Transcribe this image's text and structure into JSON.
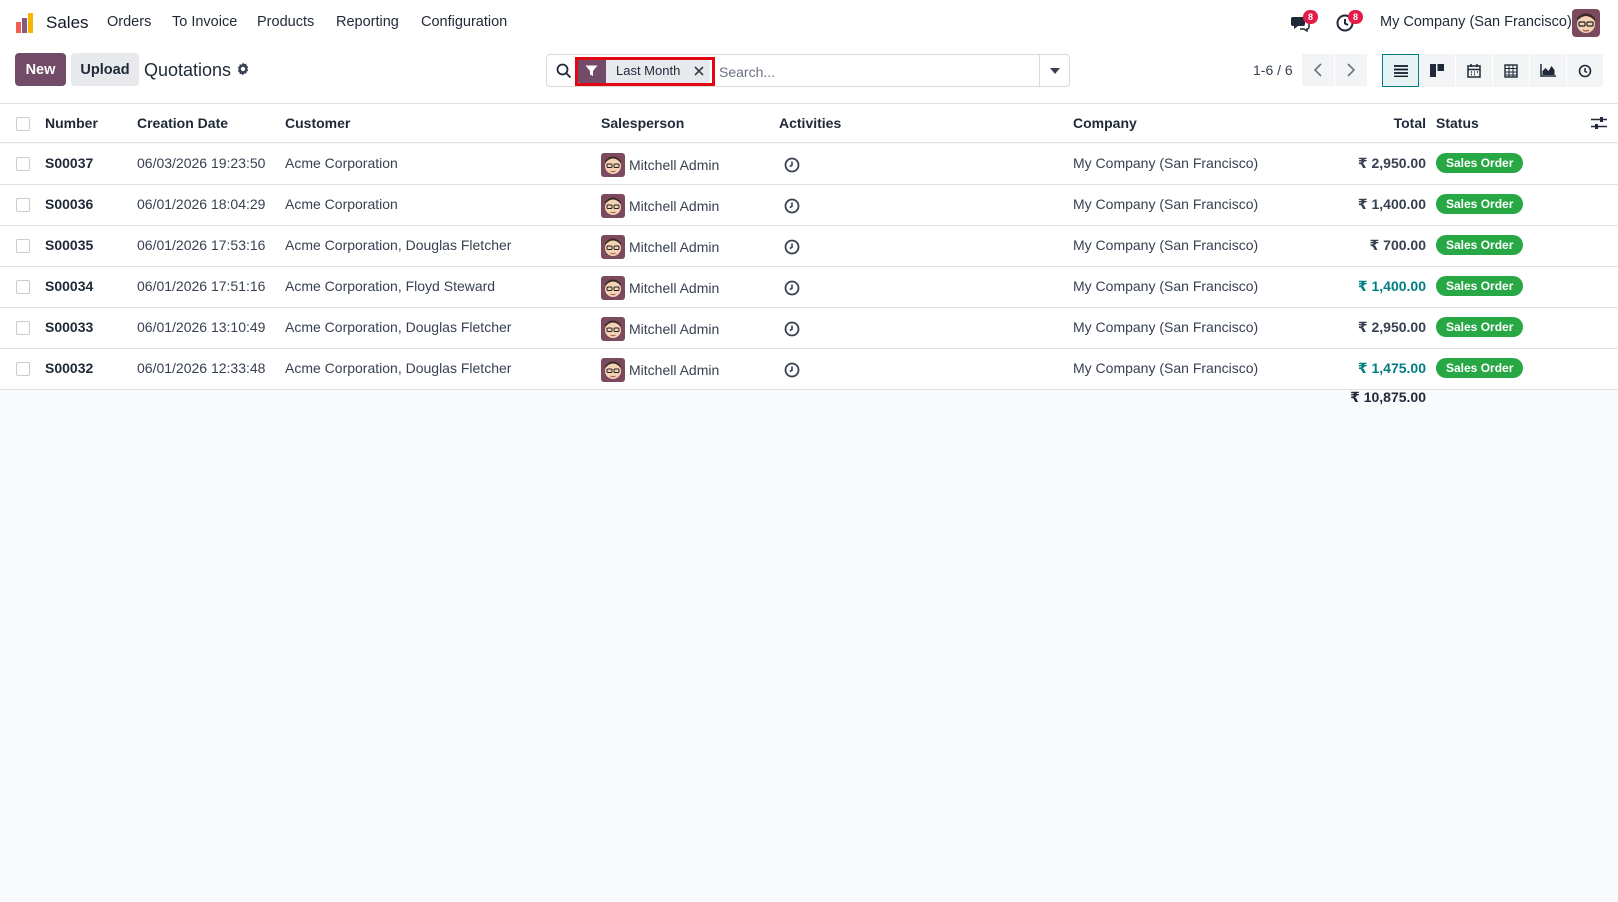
{
  "navbar": {
    "app_name": "Sales",
    "menus": [
      "Orders",
      "To Invoice",
      "Products",
      "Reporting",
      "Configuration"
    ],
    "messages_badge": "8",
    "activities_badge": "8",
    "company": "My Company (San Francisco)",
    "icons": {
      "logo": "sales-app-logo",
      "messages": "chat-icon",
      "activities": "clock-icon",
      "user": "user-avatar"
    }
  },
  "control_panel": {
    "new_label": "New",
    "upload_label": "Upload",
    "title": "Quotations",
    "search": {
      "facet_label": "Last Month",
      "placeholder": "Search..."
    },
    "pager": "1-6 / 6",
    "views": [
      "list",
      "kanban",
      "calendar",
      "pivot",
      "graph",
      "activity"
    ],
    "active_view": "list"
  },
  "table": {
    "columns": {
      "number": "Number",
      "creation_date": "Creation Date",
      "customer": "Customer",
      "salesperson": "Salesperson",
      "activities": "Activities",
      "company": "Company",
      "total": "Total",
      "status": "Status"
    },
    "rows": [
      {
        "number": "S00037",
        "date": "06/03/2026 19:23:50",
        "customer": "Acme Corporation",
        "salesperson": "Mitchell Admin",
        "company": "My Company (San Francisco)",
        "total": "₹ 2,950.00",
        "total_link": false,
        "status": "Sales Order"
      },
      {
        "number": "S00036",
        "date": "06/01/2026 18:04:29",
        "customer": "Acme Corporation",
        "salesperson": "Mitchell Admin",
        "company": "My Company (San Francisco)",
        "total": "₹ 1,400.00",
        "total_link": false,
        "status": "Sales Order"
      },
      {
        "number": "S00035",
        "date": "06/01/2026 17:53:16",
        "customer": "Acme Corporation, Douglas Fletcher",
        "salesperson": "Mitchell Admin",
        "company": "My Company (San Francisco)",
        "total": "₹ 700.00",
        "total_link": false,
        "status": "Sales Order"
      },
      {
        "number": "S00034",
        "date": "06/01/2026 17:51:16",
        "customer": "Acme Corporation, Floyd Steward",
        "salesperson": "Mitchell Admin",
        "company": "My Company (San Francisco)",
        "total": "₹ 1,400.00",
        "total_link": true,
        "status": "Sales Order"
      },
      {
        "number": "S00033",
        "date": "06/01/2026 13:10:49",
        "customer": "Acme Corporation, Douglas Fletcher",
        "salesperson": "Mitchell Admin",
        "company": "My Company (San Francisco)",
        "total": "₹ 2,950.00",
        "total_link": false,
        "status": "Sales Order"
      },
      {
        "number": "S00032",
        "date": "06/01/2026 12:33:48",
        "customer": "Acme Corporation, Douglas Fletcher",
        "salesperson": "Mitchell Admin",
        "company": "My Company (San Francisco)",
        "total": "₹ 1,475.00",
        "total_link": true,
        "status": "Sales Order"
      }
    ],
    "grand_total": "₹ 10,875.00"
  },
  "colors": {
    "brand": "#714b67",
    "link": "#017e84",
    "status_green": "#28a745",
    "highlight": "#e30613"
  }
}
